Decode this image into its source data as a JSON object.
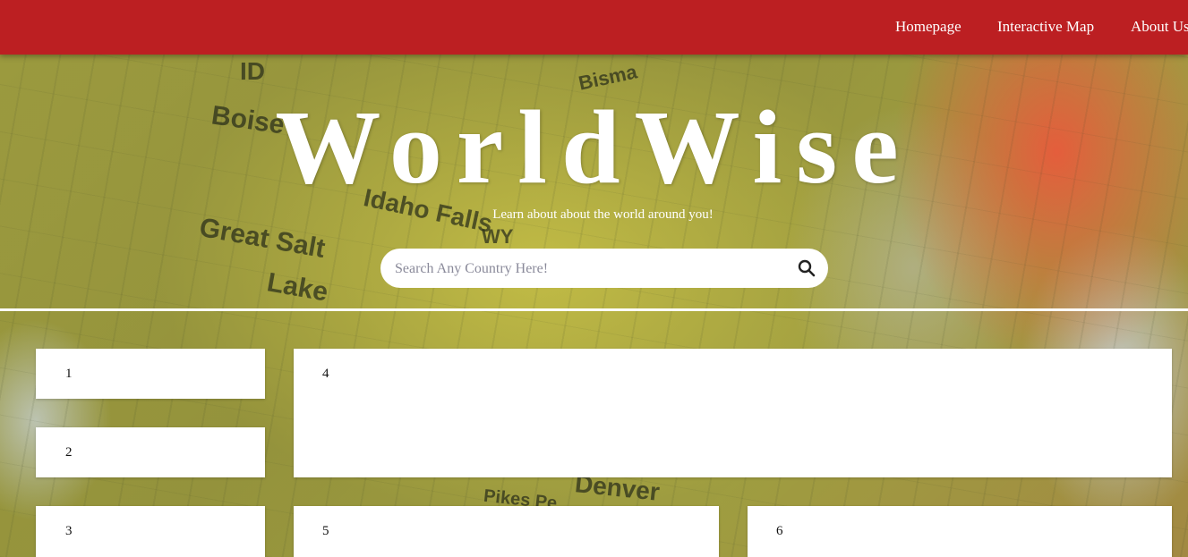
{
  "nav": {
    "links": [
      {
        "label": "Homepage"
      },
      {
        "label": "Interactive Map"
      },
      {
        "label": "About Us"
      }
    ],
    "accent": "#bc1f22"
  },
  "hero": {
    "title": "WorldWise",
    "subtitle": "Learn about about the world around you!"
  },
  "search": {
    "placeholder": "Search Any Country Here!",
    "value": "",
    "icon": "search-icon"
  },
  "map_labels": [
    "Boise",
    "Idaho Falls",
    "Great Salt",
    "Lake",
    "Denver",
    "WY",
    "ID",
    "Pikes Pe",
    "Bisma"
  ],
  "cards": [
    {
      "label": "1"
    },
    {
      "label": "2"
    },
    {
      "label": "3"
    },
    {
      "label": "4"
    },
    {
      "label": "5"
    },
    {
      "label": "6"
    }
  ]
}
